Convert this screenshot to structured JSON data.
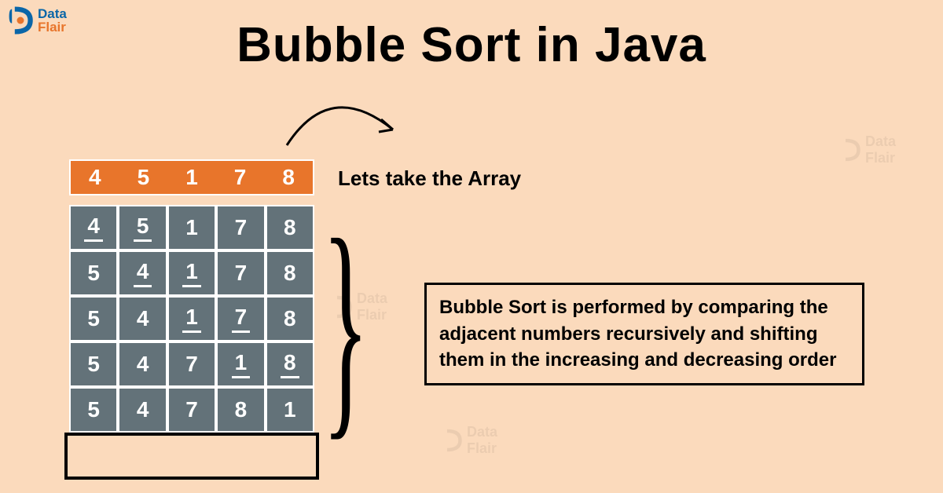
{
  "logo": {
    "data": "Data",
    "flair": "Flair"
  },
  "title": "Bubble Sort in Java",
  "array_label": "Lets take the Array",
  "initial_array": [
    "4",
    "5",
    "1",
    "7",
    "8"
  ],
  "steps": [
    {
      "cells": [
        "4",
        "5",
        "1",
        "7",
        "8"
      ],
      "underline": [
        0,
        1
      ]
    },
    {
      "cells": [
        "5",
        "4",
        "1",
        "7",
        "8"
      ],
      "underline": [
        1,
        2
      ]
    },
    {
      "cells": [
        "5",
        "4",
        "1",
        "7",
        "8"
      ],
      "underline": [
        2,
        3
      ]
    },
    {
      "cells": [
        "5",
        "4",
        "7",
        "1",
        "8"
      ],
      "underline": [
        3,
        4
      ]
    },
    {
      "cells": [
        "5",
        "4",
        "7",
        "8",
        "1"
      ],
      "underline": []
    }
  ],
  "description": "Bubble Sort is performed by comparing the adjacent numbers recursively and shifting them in the increasing and decreasing order"
}
